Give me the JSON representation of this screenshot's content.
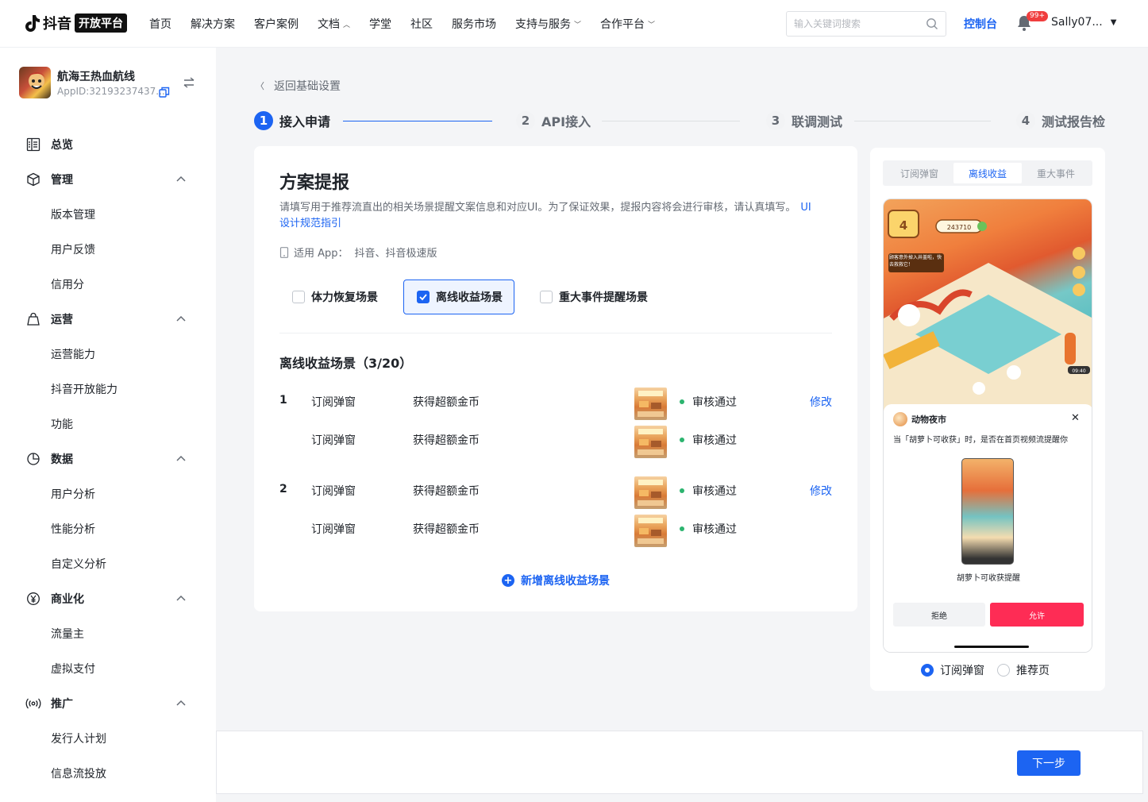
{
  "header": {
    "logo_text": "抖音",
    "logo_badge": "开放平台",
    "nav": [
      {
        "label": "首页",
        "caret": false
      },
      {
        "label": "解决方案",
        "caret": false
      },
      {
        "label": "客户案例",
        "caret": false
      },
      {
        "label": "文档",
        "caret": true
      },
      {
        "label": "学堂",
        "caret": false
      },
      {
        "label": "社区",
        "caret": false
      },
      {
        "label": "服务市场",
        "caret": false
      },
      {
        "label": "支持与服务",
        "caret": true
      },
      {
        "label": "合作平台",
        "caret": true
      }
    ],
    "search_placeholder": "输入关键词搜索",
    "console": "控制台",
    "bell_badge": "99+",
    "user": "Sally07..."
  },
  "sidebar": {
    "app_name": "航海王热血航线",
    "app_id": "AppID:32193237437...",
    "overview": "总览",
    "groups": [
      {
        "label": "管理",
        "icon": "cube-icon",
        "items": [
          "版本管理",
          "用户反馈",
          "信用分"
        ]
      },
      {
        "label": "运营",
        "icon": "bag-icon",
        "items": [
          "运营能力",
          "抖音开放能力",
          "功能"
        ]
      },
      {
        "label": "数据",
        "icon": "pie-chart-icon",
        "items": [
          "用户分析",
          "性能分析",
          "自定义分析"
        ]
      },
      {
        "label": "商业化",
        "icon": "yuan-icon",
        "items": [
          "流量主",
          "虚拟支付"
        ]
      },
      {
        "label": "推广",
        "icon": "broadcast-icon",
        "items": [
          "发行人计划",
          "信息流投放"
        ]
      }
    ]
  },
  "main": {
    "back": "返回基础设置",
    "steps": [
      {
        "num": "1",
        "label": "接入申请"
      },
      {
        "num": "2",
        "label": "API接入"
      },
      {
        "num": "3",
        "label": "联调测试"
      },
      {
        "num": "4",
        "label": "测试报告检"
      }
    ],
    "title": "方案提报",
    "desc": "请填写用于推荐流直出的相关场景提醒文案信息和对应UI。为了保证效果，提报内容将会进行审核，请认真填写。",
    "desc_link": "UI设计规范指引",
    "apps_label": "适用 App：",
    "apps_value": "抖音、抖音极速版",
    "options": [
      {
        "label": "体力恢复场景",
        "checked": false
      },
      {
        "label": "离线收益场景",
        "checked": true
      },
      {
        "label": "重大事件提醒场景",
        "checked": false
      }
    ],
    "section_title": "离线收益场景（3/20）",
    "rows": [
      {
        "idx": "1",
        "type": "订阅弹窗",
        "text": "获得超额金币",
        "status": "审核通过",
        "edit": "修改"
      },
      {
        "idx": "",
        "type": "订阅弹窗",
        "text": "获得超额金币",
        "status": "审核通过",
        "edit": ""
      },
      {
        "idx": "2",
        "type": "订阅弹窗",
        "text": "获得超额金币",
        "status": "审核通过",
        "edit": "修改"
      },
      {
        "idx": "",
        "type": "订阅弹窗",
        "text": "获得超额金币",
        "status": "审核通过",
        "edit": ""
      }
    ],
    "add_label": "新增离线收益场景",
    "next": "下一步"
  },
  "preview": {
    "tabs": [
      "订阅弹窗",
      "离线收益",
      "重大事件"
    ],
    "active_tab": "离线收益",
    "game_score": "243710",
    "game_level": "4",
    "game_hint": "顾客意外掉入井盖啦，快去救救它！",
    "game_time": "09:40",
    "sheet_title": "动物夜市",
    "sheet_text": "当「胡萝卜可收获」时，是否在首页视频流提醒你",
    "mini_caption": "胡萝卜可收获提醒",
    "deny": "拒绝",
    "allow": "允许",
    "radios": [
      {
        "label": "订阅弹窗",
        "on": true
      },
      {
        "label": "推荐页",
        "on": false
      }
    ]
  },
  "colors": {
    "primary": "#1c64f2",
    "success": "#2cb46f",
    "allow": "#fe2c55"
  }
}
